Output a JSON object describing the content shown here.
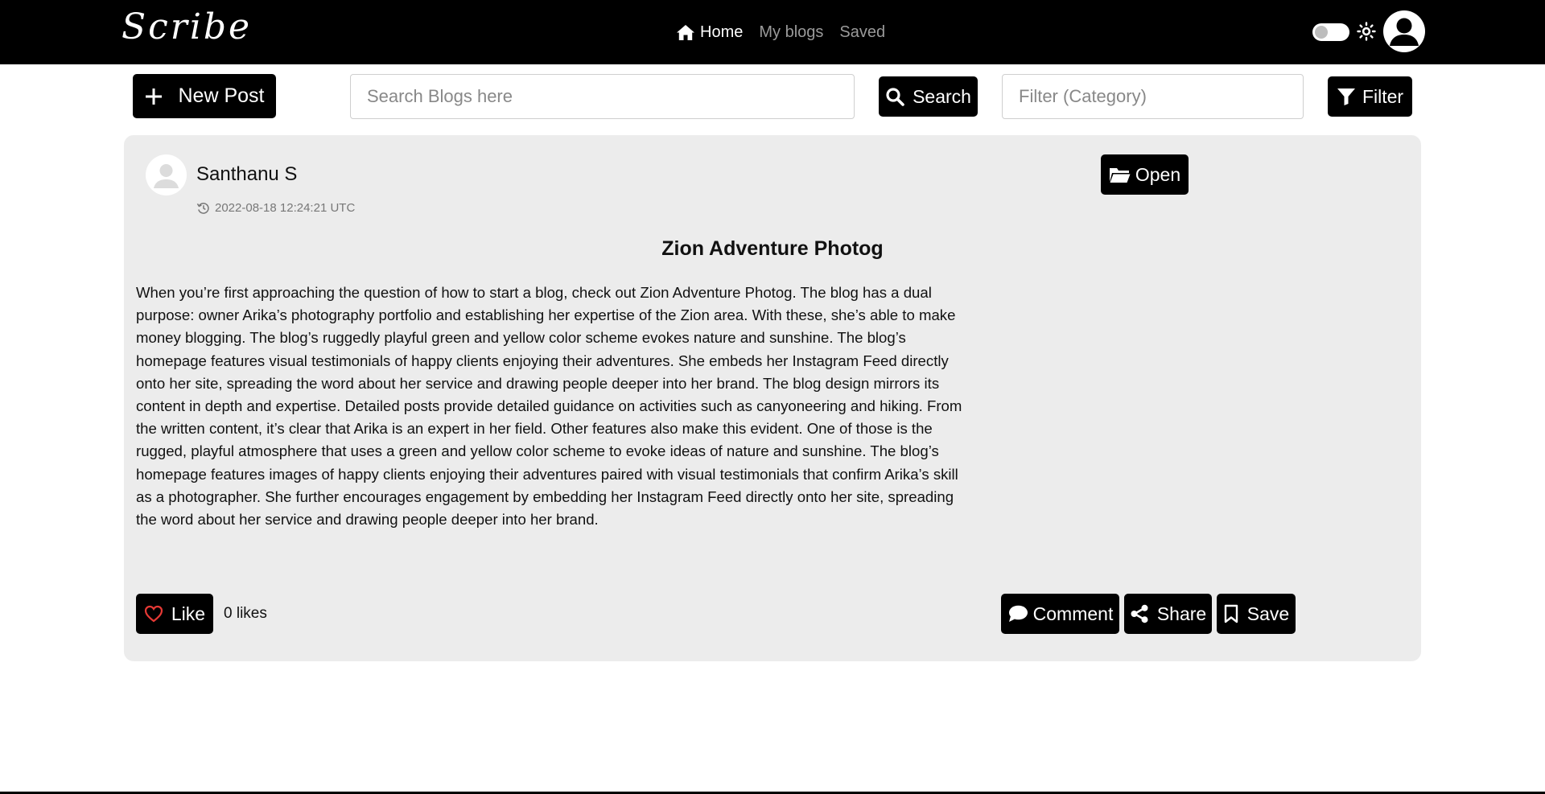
{
  "navbar": {
    "brand": "Scribe",
    "links": [
      {
        "label": "Home",
        "icon": "home-icon",
        "active": true
      },
      {
        "label": "My blogs",
        "active": false
      },
      {
        "label": "Saved",
        "active": false
      }
    ],
    "theme_toggle": {
      "on": false
    },
    "theme_icon": "sun-icon",
    "profile_icon": "user-avatar-icon"
  },
  "toolbar": {
    "new_post_label": "New Post",
    "search_placeholder": "Search Blogs here",
    "search_label": "Search",
    "filter_placeholder": "Filter (Category)",
    "filter_label": "Filter"
  },
  "post": {
    "author": "Santhanu S",
    "timestamp": "2022-08-18 12:24:21 UTC",
    "open_label": "Open",
    "title": "Zion Adventure Photog",
    "body": "When you’re first approaching the question of how to start a blog, check out Zion Adventure Photog. The blog has a dual purpose: owner Arika’s photography portfolio and establishing her expertise of the Zion area. With these, she’s able to make money blogging. The blog’s ruggedly playful green and yellow color scheme evokes nature and sunshine. The blog’s homepage features visual testimonials of happy clients enjoying their adventures. She embeds her Instagram Feed directly onto her site, spreading the word about her service and drawing people deeper into her brand. The blog design mirrors its content in depth and expertise. Detailed posts provide detailed guidance on activities such as canyoneering and hiking. From the written content, it’s clear that Arika is an expert in her field. Other features also make this evident. One of those is the rugged, playful atmosphere that uses a green and yellow color scheme to evoke ideas of nature and sunshine. The blog’s homepage features images of happy clients enjoying their adventures paired with visual testimonials that confirm Arika’s skill as a photographer. She further encourages engagement by embedding her Instagram Feed directly onto her site, spreading the word about her service and drawing people deeper into her brand.",
    "like_label": "Like",
    "likes_text": "0 likes",
    "comment_label": "Comment",
    "share_label": "Share",
    "save_label": "Save"
  },
  "colors": {
    "navbar_bg": "#000000",
    "card_bg": "#ececec",
    "button_bg": "#000000",
    "heart": "#e53935"
  }
}
